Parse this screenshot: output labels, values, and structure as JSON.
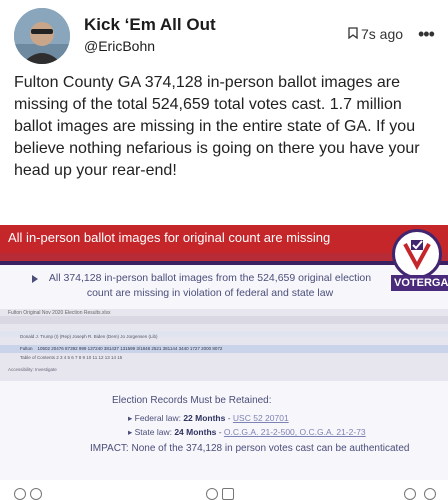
{
  "post": {
    "author_name": "Kick ‘Em All Out",
    "author_handle": "@EricBohn",
    "time_ago": "7s ago",
    "body": "Fulton County GA 374,128 in-person ballot images are missing of the total 524,659 total votes cast. 1.7 million ballot images are missing in the entire state of GA. If you believe nothing nefarious is going on there you have your head up your rear-end!"
  },
  "media": {
    "banner": "All in-person ballot images for original count are missing",
    "logo_text": "VOTERGA",
    "claim": "All 374,128 in-person ballot images from the 524,659 original election count are missing in violation of federal and state law",
    "spreadsheet": {
      "title": "Fulton Original Nov 2020 Election Results.xlsx",
      "header": "Donald J. Trump (I) (Rep)          Joseph R. Biden (Dem)          Jo Jorgensen (Lib)",
      "row_label": "Fulton",
      "row_values": "10502   20476   87392   999   137240   381437   131599   3/1848   2521   381144   3440   1727   2000   8072",
      "sub_row": "Table of Contents   2   3   4   5   6   7   8   9   10   11   12   13   14   15",
      "status": "Accessibility: Investigate"
    },
    "records_title": "Election Records Must be Retained:",
    "federal_label": "Federal law: ",
    "federal_value": "22 Months",
    "federal_ref": "USC 52 20701",
    "state_label": "State law: ",
    "state_value": "24 Months",
    "state_ref": "O.C.G.A. 21-2-500, O.C.G.A. 21-2-73",
    "impact": "IMPACT: None of the 374,128 in person votes cast can be authenticated"
  },
  "colors": {
    "banner": "#c4262a",
    "slide_text": "#4a4e79",
    "logo_purple": "#4a2a7b"
  },
  "icons": {
    "bookmark": "bookmark-icon",
    "more": "more-options-icon"
  }
}
